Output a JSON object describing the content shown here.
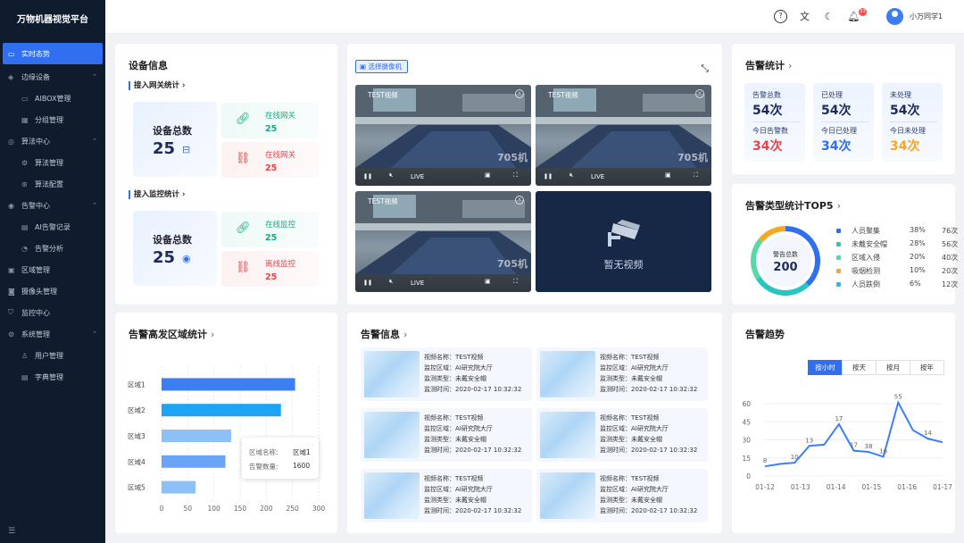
{
  "app": {
    "title": "万物机器视觉平台"
  },
  "nav": [
    {
      "label": "实时态势",
      "icon": "monitor-icon",
      "level": 0,
      "active": true
    },
    {
      "label": "边缘设备",
      "icon": "device-icon",
      "level": 0,
      "expanded": true
    },
    {
      "label": "AIBOX管理",
      "icon": "box-icon",
      "level": 1
    },
    {
      "label": "分组管理",
      "icon": "group-icon",
      "level": 1
    },
    {
      "label": "算法中心",
      "icon": "algorithm-icon",
      "level": 0,
      "expanded": true
    },
    {
      "label": "算法管理",
      "icon": "gear-icon",
      "level": 1
    },
    {
      "label": "算法配置",
      "icon": "config-icon",
      "level": 1
    },
    {
      "label": "告警中心",
      "icon": "alarm-icon",
      "level": 0,
      "expanded": true
    },
    {
      "label": "AI告警记录",
      "icon": "record-icon",
      "level": 1
    },
    {
      "label": "告警分析",
      "icon": "analysis-icon",
      "level": 1
    },
    {
      "label": "区域管理",
      "icon": "region-icon",
      "level": 0
    },
    {
      "label": "摄像头管理",
      "icon": "camera-icon",
      "level": 0
    },
    {
      "label": "监控中心",
      "icon": "shield-icon",
      "level": 0
    },
    {
      "label": "系统管理",
      "icon": "system-icon",
      "level": 0,
      "expanded": true
    },
    {
      "label": "用户管理",
      "icon": "user-icon",
      "level": 1
    },
    {
      "label": "字典管理",
      "icon": "dictionary-icon",
      "level": 1
    }
  ],
  "topbar": {
    "username": "小万同学1",
    "notification_count": "12"
  },
  "device_info": {
    "title": "设备信息",
    "gateway": {
      "title": "接入网关统计",
      "total_label": "设备总数",
      "total": "25",
      "online_label": "在线网关",
      "online": "25",
      "offline_label": "在线网关",
      "offline": "25"
    },
    "monitor": {
      "title": "接入监控统计",
      "total_label": "设备总数",
      "total": "25",
      "online_label": "在线监控",
      "online": "25",
      "offline_label": "离线监控",
      "offline": "25"
    }
  },
  "video": {
    "select_label": "选择摄像机",
    "tiles": [
      {
        "title": "TEST视频",
        "live": "LIVE",
        "watermark": "705机"
      },
      {
        "title": "TEST视频",
        "live": "LIVE",
        "watermark": "705机"
      },
      {
        "title": "TEST视频",
        "live": "LIVE",
        "watermark": "705机"
      }
    ],
    "empty_label": "暂无视频"
  },
  "alarm_stats": {
    "title": "告警统计",
    "cards": [
      {
        "label1": "告警总数",
        "value1": "54次",
        "label2": "今日告警数",
        "value2": "34次",
        "color2": "#e0454a"
      },
      {
        "label1": "已处理",
        "value1": "54次",
        "label2": "今日已处理",
        "value2": "34次",
        "color2": "#2f6ff0"
      },
      {
        "label1": "未处理",
        "value1": "54次",
        "label2": "今日未处理",
        "value2": "34次",
        "color2": "#f5a623"
      }
    ]
  },
  "alarm_type": {
    "title": "告警类型统计TOP5",
    "donut_label": "警告总数",
    "donut_value": "200",
    "items": [
      {
        "name": "人员聚集",
        "pct": "38%",
        "count": "76次",
        "color": "#2f6ff0"
      },
      {
        "name": "未戴安全帽",
        "pct": "28%",
        "count": "56次",
        "color": "#27c6c0"
      },
      {
        "name": "区域入侵",
        "pct": "20%",
        "count": "40次",
        "color": "#5ad8a6"
      },
      {
        "name": "吸烟检测",
        "pct": "10%",
        "count": "20次",
        "color": "#f6a821"
      },
      {
        "name": "人员跌倒",
        "pct": "6%",
        "count": "12次",
        "color": "#36b4e6"
      }
    ]
  },
  "region_stats": {
    "title": "告警高发区域统计",
    "tooltip": {
      "name_label": "区域名称:",
      "name": "区域1",
      "count_label": "告警数量:",
      "count": "1600"
    }
  },
  "alarm_info": {
    "title": "告警信息",
    "items": [
      {
        "l1": "视频名称：TEST视频",
        "l2": "监控区域：AI研究院大厅",
        "l3": "监测类型：未戴安全帽",
        "l4": "监测时间：2020-02-17 10:32:32"
      },
      {
        "l1": "视频名称：TEST视频",
        "l2": "监控区域：AI研究院大厅",
        "l3": "监测类型：未戴安全帽",
        "l4": "监测时间：2020-02-17 10:32:32"
      },
      {
        "l1": "视频名称：TEST视频",
        "l2": "监控区域：AI研究院大厅",
        "l3": "监测类型：未戴安全帽",
        "l4": "监测时间：2020-02-17 10:32:32"
      },
      {
        "l1": "视频名称：TEST视频",
        "l2": "监控区域：AI研究院大厅",
        "l3": "监测类型：未戴安全帽",
        "l4": "监测时间：2020-02-17 10:32:32"
      },
      {
        "l1": "视频名称：TEST视频",
        "l2": "监控区域：AI研究院大厅",
        "l3": "监测类型：未戴安全帽",
        "l4": "监测时间：2020-02-17 10:32:32"
      },
      {
        "l1": "视频名称：TEST视频",
        "l2": "监控区域：AI研究院大厅",
        "l3": "监测类型：未戴安全帽",
        "l4": "监测时间：2020-02-17 10:32:32"
      }
    ]
  },
  "trend": {
    "title": "告警趋势",
    "tabs": [
      "按小时",
      "按天",
      "按月",
      "按年"
    ],
    "active_tab": "按小时"
  },
  "chart_data": [
    {
      "type": "bar",
      "orientation": "horizontal",
      "categories": [
        "区域1",
        "区域2",
        "区域3",
        "区域4",
        "区域5"
      ],
      "values": [
        255,
        228,
        133,
        122,
        65
      ],
      "colors": [
        "#3d7ef5",
        "#1ea4f5",
        "#8cc0f7",
        "#6aa4f5",
        "#8cc0f7"
      ],
      "xlim": [
        0,
        300
      ],
      "xticks": [
        0,
        50,
        100,
        150,
        200,
        250,
        300
      ],
      "grid": true
    },
    {
      "type": "line",
      "x": [
        0,
        1,
        2,
        3,
        4,
        5,
        6,
        7,
        8,
        9,
        10,
        11,
        12
      ],
      "xticks": [
        "01-12",
        "01-13",
        "01-14",
        "01-15",
        "01-16",
        "01-17"
      ],
      "values": [
        8,
        10,
        11,
        25,
        26,
        43,
        21,
        20,
        16,
        61,
        38,
        31,
        28
      ],
      "point_labels": [
        {
          "i": 0,
          "text": "8"
        },
        {
          "i": 2,
          "text": "10"
        },
        {
          "i": 3,
          "text": "13"
        },
        {
          "i": 5,
          "text": "17"
        },
        {
          "i": 6,
          "text": "17"
        },
        {
          "i": 7,
          "text": "38"
        },
        {
          "i": 8,
          "text": "16"
        },
        {
          "i": 9,
          "text": "55"
        },
        {
          "i": 11,
          "text": "14"
        }
      ],
      "ylim": [
        0,
        60
      ],
      "yticks": [
        0,
        15,
        30,
        45,
        60
      ],
      "color": "#3d7ef5"
    }
  ]
}
